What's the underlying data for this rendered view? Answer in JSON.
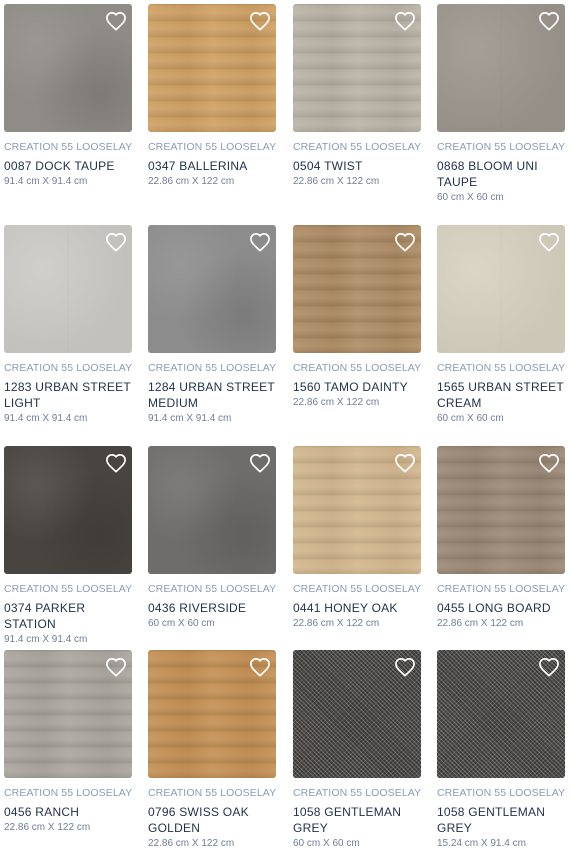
{
  "colors": {
    "brand_text": "#8a9bb9",
    "name_text": "#1f3049",
    "dim_text": "#6f7e97",
    "heart_icon": "#ffffff"
  },
  "products": [
    {
      "brand": "CREATION 55 LOOSELAY",
      "name": "0087 DOCK TAUPE",
      "size": "91.4 cm X 91.4 cm",
      "swatch": "#8f8b86",
      "texture": "stone"
    },
    {
      "brand": "CREATION 55 LOOSELAY",
      "name": "0347 BALLERINA",
      "size": "22.86 cm X 122 cm",
      "swatch": "#cf9f62",
      "texture": "wood"
    },
    {
      "brand": "CREATION 55 LOOSELAY",
      "name": "0504 TWIST",
      "size": "22.86 cm X 122 cm",
      "swatch": "#b9b2a6",
      "texture": "wood"
    },
    {
      "brand": "CREATION 55 LOOSELAY",
      "name": "0868 BLOOM UNI TAUPE",
      "size": "60 cm X 60 cm",
      "swatch": "#9d978f",
      "texture": "tile"
    },
    {
      "brand": "CREATION 55 LOOSELAY",
      "name": "1283 URBAN STREET LIGHT",
      "size": "91.4 cm X 91.4 cm",
      "swatch": "#cdcbc8",
      "texture": "tile"
    },
    {
      "brand": "CREATION 55 LOOSELAY",
      "name": "1284 URBAN STREET MEDIUM",
      "size": "91.4 cm X 91.4 cm",
      "swatch": "#8c8c8c",
      "texture": "stone"
    },
    {
      "brand": "CREATION 55 LOOSELAY",
      "name": "1560 TAMO DAINTY",
      "size": "22.86 cm X 122 cm",
      "swatch": "#ad8b63",
      "texture": "wood"
    },
    {
      "brand": "CREATION 55 LOOSELAY",
      "name": "1565 URBAN STREET CREAM",
      "size": "60 cm X 60 cm",
      "swatch": "#d8d2c1",
      "texture": "tile"
    },
    {
      "brand": "CREATION 55 LOOSELAY",
      "name": "0374 PARKER STATION",
      "size": "91.4 cm X 91.4 cm",
      "swatch": "#48443f",
      "texture": "stone"
    },
    {
      "brand": "CREATION 55 LOOSELAY",
      "name": "0436 RIVERSIDE",
      "size": "60 cm X 60 cm",
      "swatch": "#6e6d6b",
      "texture": "stone"
    },
    {
      "brand": "CREATION 55 LOOSELAY",
      "name": "0441 HONEY OAK",
      "size": "22.86 cm X 122 cm",
      "swatch": "#d2b68d",
      "texture": "wood"
    },
    {
      "brand": "CREATION 55 LOOSELAY",
      "name": "0455 LONG BOARD",
      "size": "22.86 cm X 122 cm",
      "swatch": "#9a8775",
      "texture": "wood"
    },
    {
      "brand": "CREATION 55 LOOSELAY",
      "name": "0456 RANCH",
      "size": "22.86 cm X 122 cm",
      "swatch": "#aaa49d",
      "texture": "wood"
    },
    {
      "brand": "CREATION 55 LOOSELAY",
      "name": "0796 SWISS OAK GOLDEN",
      "size": "22.86 cm X 122 cm",
      "swatch": "#c38f52",
      "texture": "wood"
    },
    {
      "brand": "CREATION 55 LOOSELAY",
      "name": "1058 GENTLEMAN GREY",
      "size": "60 cm X 60 cm",
      "swatch": "#4c4b4a",
      "texture": "weave"
    },
    {
      "brand": "CREATION 55 LOOSELAY",
      "name": "1058 GENTLEMAN GREY",
      "size": "15.24 cm X 91.4 cm",
      "swatch": "#4e4d4c",
      "texture": "weave"
    }
  ]
}
